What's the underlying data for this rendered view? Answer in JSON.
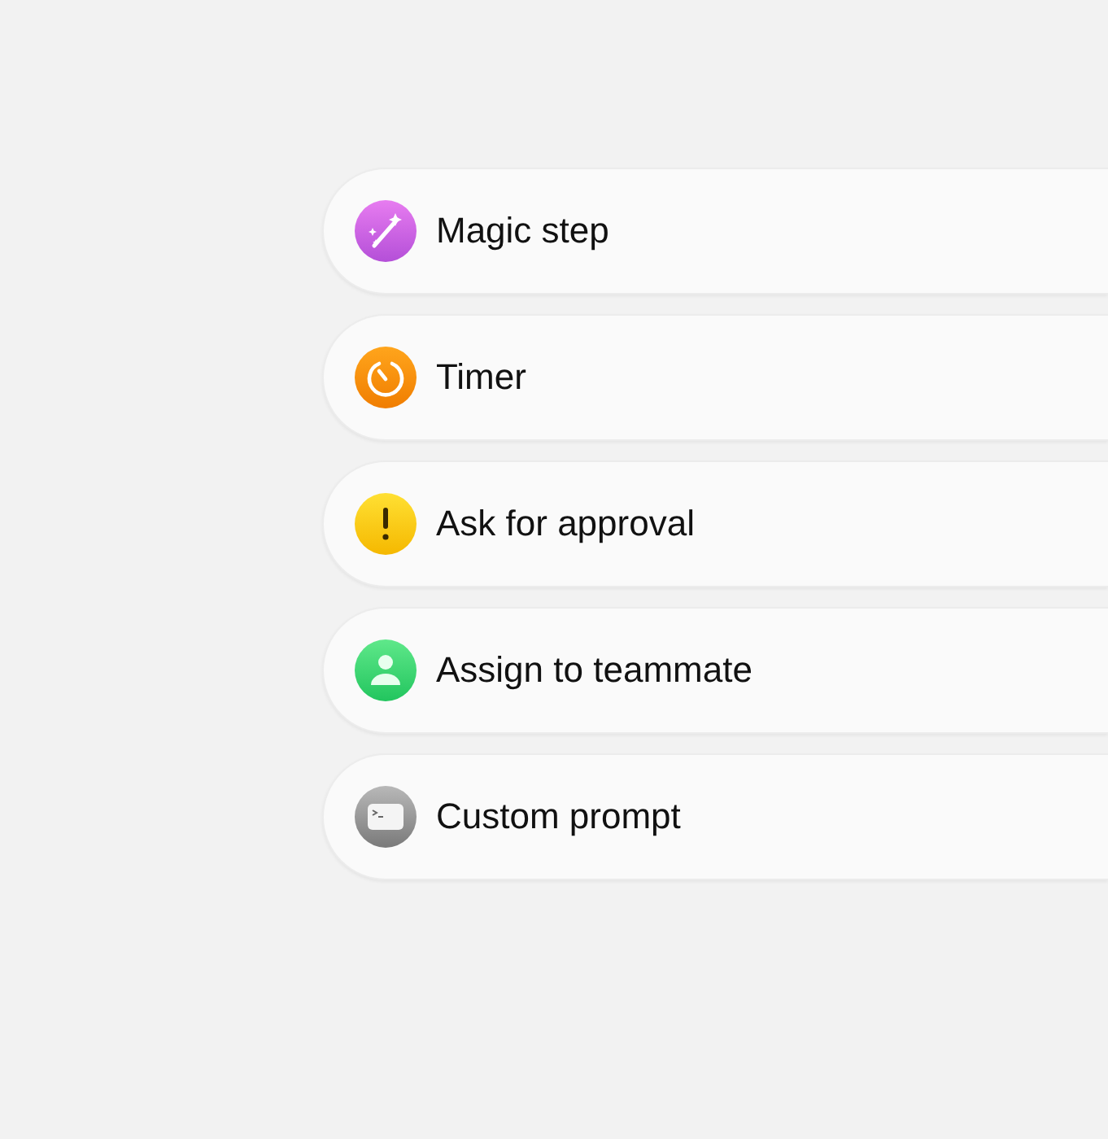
{
  "steps": [
    {
      "kind": "magic",
      "label": "Magic step"
    },
    {
      "kind": "timer",
      "label": "Timer"
    },
    {
      "kind": "approval",
      "label": "Ask for approval"
    },
    {
      "kind": "assign",
      "label": "Assign to teammate"
    },
    {
      "kind": "prompt",
      "label": "Custom prompt"
    }
  ]
}
